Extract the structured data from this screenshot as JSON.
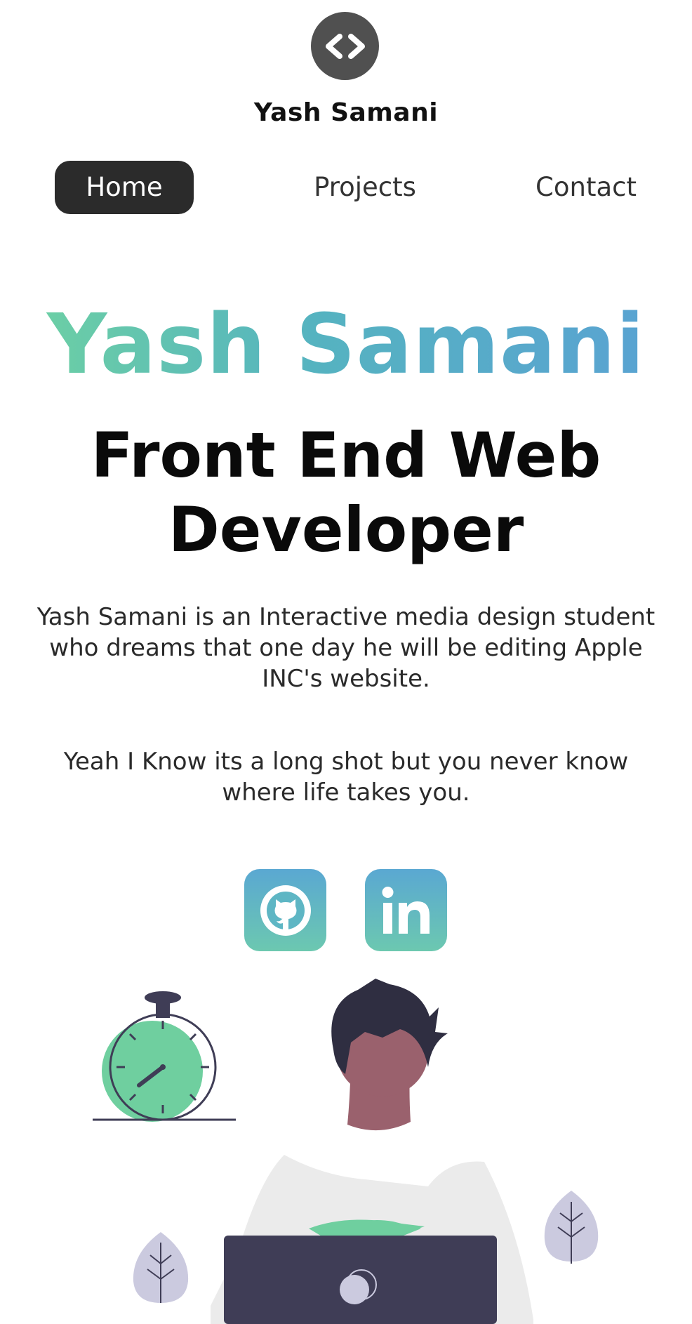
{
  "header": {
    "logo_icon": "code-brackets-icon",
    "brand_name": "Yash Samani"
  },
  "nav": {
    "items": [
      {
        "label": "Home",
        "active": true
      },
      {
        "label": "Projects",
        "active": false
      },
      {
        "label": "Contact",
        "active": false
      }
    ]
  },
  "hero": {
    "name": "Yash Samani",
    "title_line1": "Front End Web",
    "title_line2": "Developer",
    "bio": "Yash Samani is an Interactive media design student who dreams that one day he will be editing Apple INC's website.",
    "bio_2": "Yeah I Know its a long shot but you never know where life takes you."
  },
  "social": {
    "github_icon": "github-icon",
    "linkedin_icon": "linkedin-icon"
  },
  "colors": {
    "gradient_start": "#6fd3a1",
    "gradient_end": "#5aa1d4",
    "nav_active_bg": "#2b2b2b",
    "logo_bg": "#505050",
    "illustration_dark": "#3f3d56",
    "illustration_skin": "#9a616d",
    "illustration_green": "#6fcf9f",
    "illustration_leaf": "#cbcadf"
  }
}
